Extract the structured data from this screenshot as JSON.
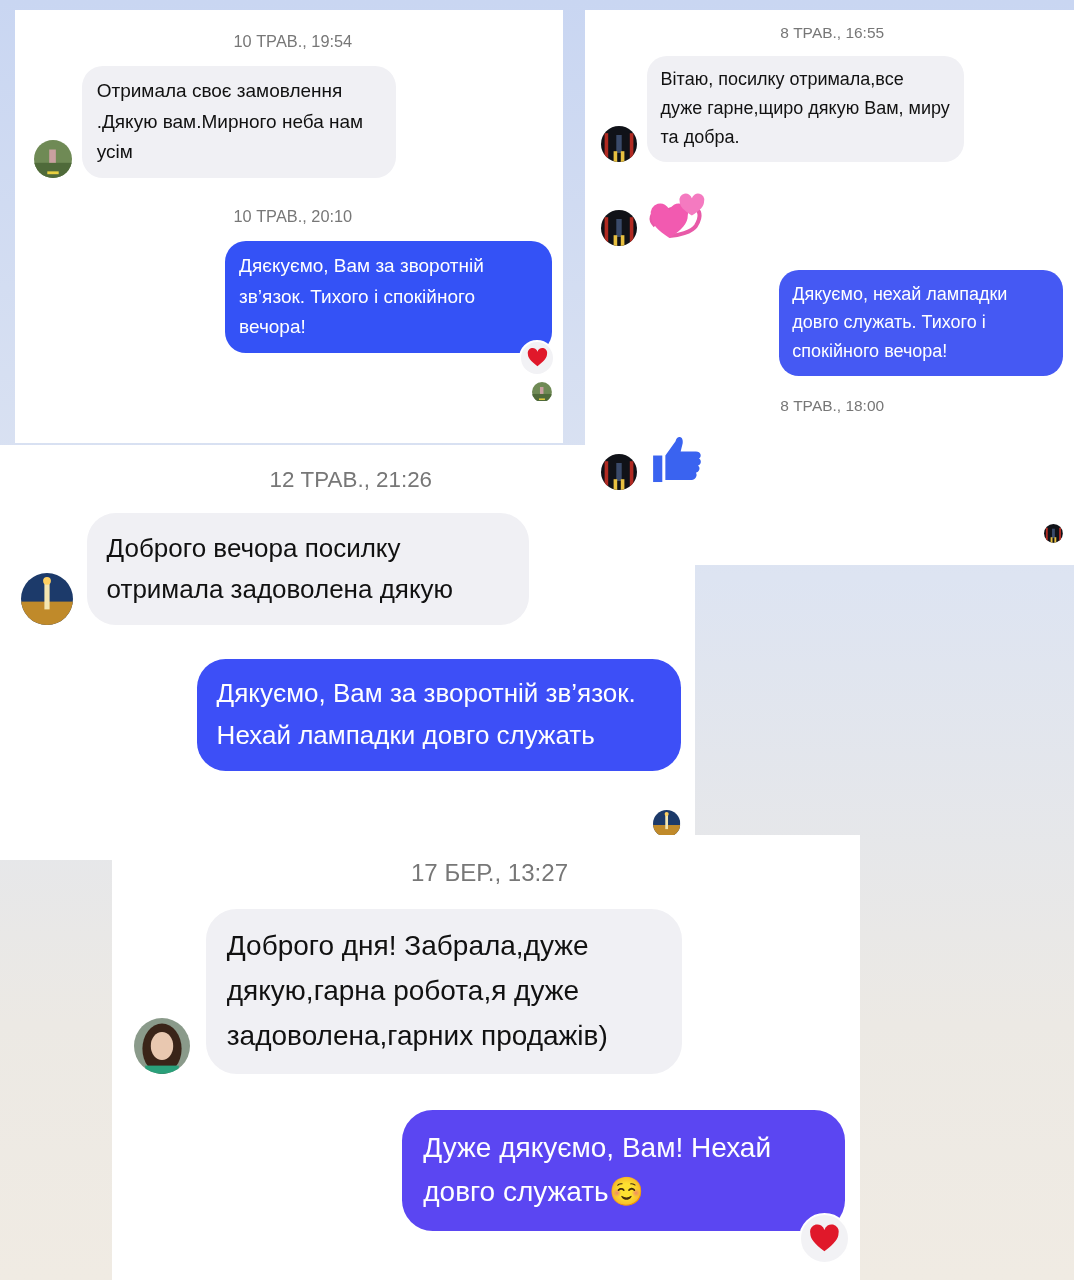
{
  "panels": [
    {
      "messages": [
        {
          "kind": "timestamp",
          "text": "10 ТРАВ., 19:54"
        },
        {
          "kind": "incoming",
          "text": "Отримала своє замовлення .Дякую вам.Мирного неба нам усім"
        },
        {
          "kind": "timestamp",
          "text": "10 ТРАВ., 20:10"
        },
        {
          "kind": "outgoing",
          "text": "Дяєкуємо, Вам за зворотній зв’язок. Тихого і спокійного вечора!",
          "reacted": true
        },
        {
          "kind": "seen"
        }
      ]
    },
    {
      "messages": [
        {
          "kind": "timestamp",
          "text": "8 ТРАВ., 16:55"
        },
        {
          "kind": "incoming",
          "text": "Вітаю, посилку отримала,все дуже гарне,щиро дякую Вам, миру та добра."
        },
        {
          "kind": "hearts"
        },
        {
          "kind": "outgoing",
          "text": "Дякуємо, нехай лампадки довго служать. Тихого і спокійного вечора!",
          "reacted": false
        },
        {
          "kind": "timestamp",
          "text": "8 ТРАВ., 18:00"
        },
        {
          "kind": "like"
        },
        {
          "kind": "seen"
        }
      ]
    },
    {
      "messages": [
        {
          "kind": "timestamp",
          "text": "12 ТРАВ., 21:26"
        },
        {
          "kind": "incoming",
          "text": "Доброго вечора посилку отримала задоволена дякую"
        },
        {
          "kind": "outgoing",
          "text": "Дякуємо, Вам за зворотній зв’язок. Нехай лампадки довго служать",
          "reacted": false
        },
        {
          "kind": "seen"
        }
      ]
    },
    {
      "messages": [
        {
          "kind": "timestamp",
          "text": "17 БЕР., 13:27"
        },
        {
          "kind": "incoming",
          "text": "Доброго дня! Забрала,дуже дякую,гарна робота,я дуже задоволена,гарних продажів)"
        },
        {
          "kind": "outgoing",
          "text": "Дуже дякуємо, Вам! Нехай довго служать☺️",
          "reacted": true
        }
      ]
    }
  ]
}
